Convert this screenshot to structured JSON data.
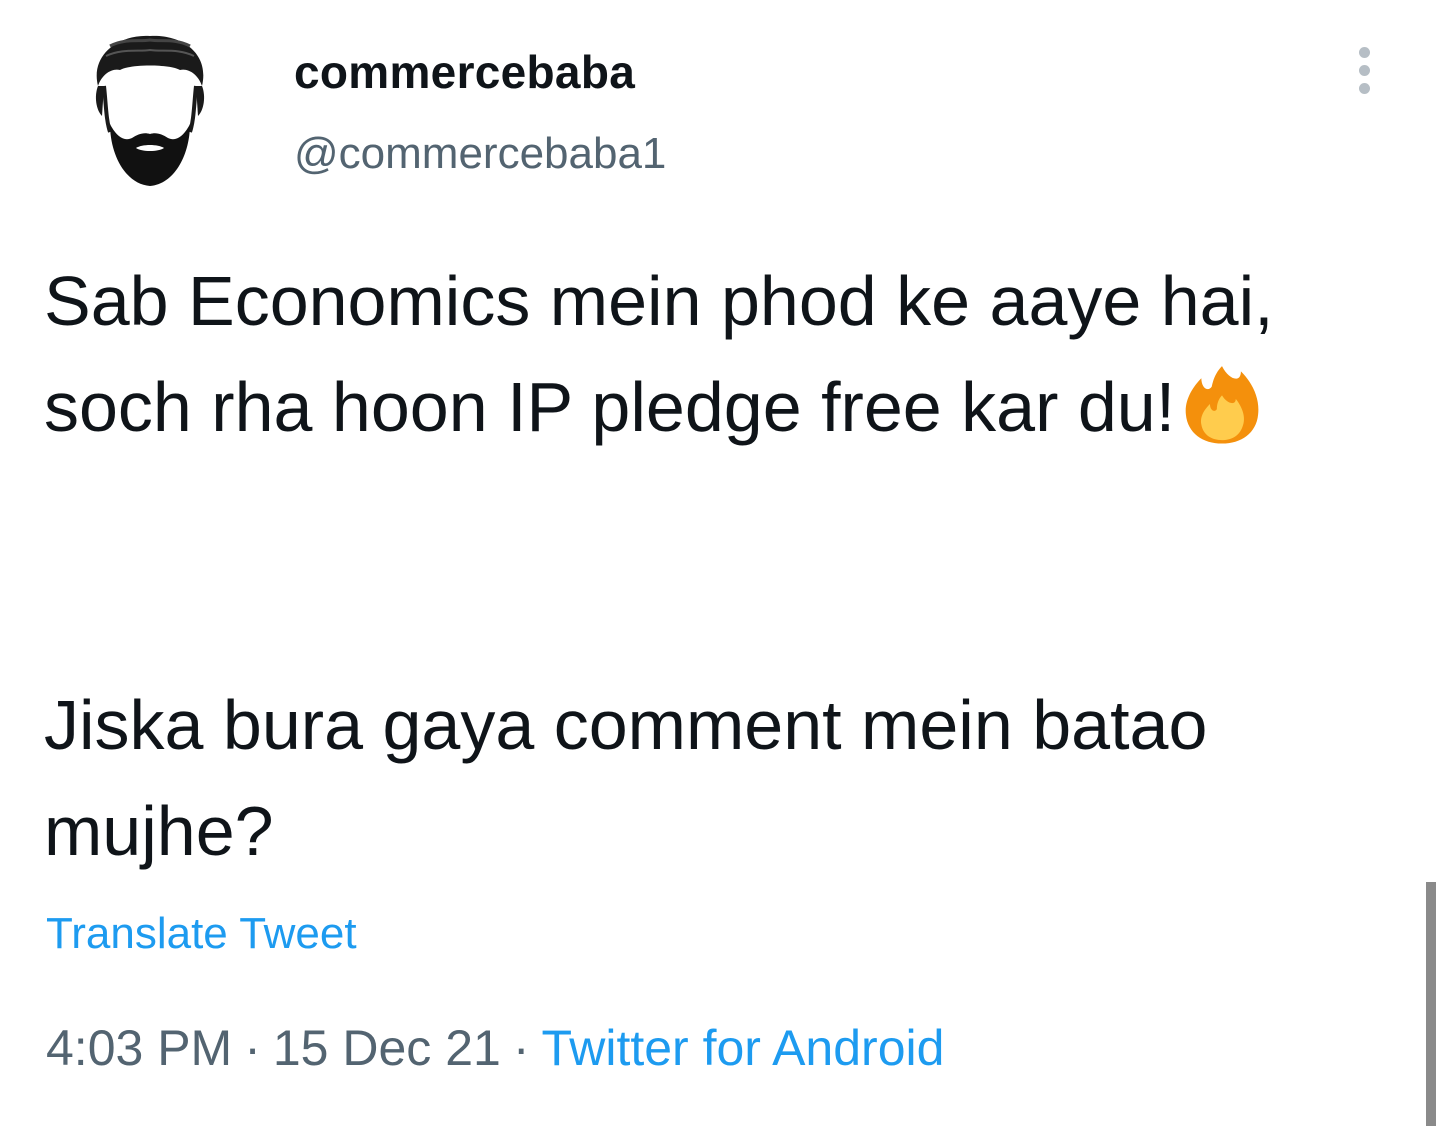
{
  "tweet": {
    "author": {
      "display_name": "commercebaba",
      "handle": "@commercebaba1",
      "avatar_icon": "bearded-man-icon"
    },
    "more_icon": "more-vertical-icon",
    "text_paragraph_1": "Sab Economics mein phod ke aaye hai, soch rha hoon IP pledge free kar du!",
    "emoji": "fire-emoji",
    "text_paragraph_2": "Jiska bura gaya comment mein batao mujhe?",
    "translate_label": "Translate Tweet",
    "time": "4:03 PM",
    "date": "15 Dec 21",
    "separator": "·",
    "source": "Twitter for Android"
  },
  "colors": {
    "text_primary": "#0f1419",
    "text_secondary": "#536471",
    "link": "#1d9bf0"
  }
}
